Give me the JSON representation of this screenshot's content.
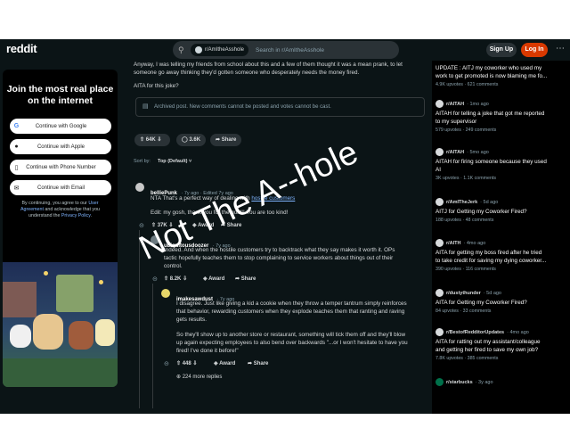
{
  "header": {
    "logo": "reddit",
    "chip": "r/AmItheAsshole",
    "search_placeholder": "Search in r/AmItheAsshole",
    "signup": "Sign Up",
    "login": "Log In"
  },
  "card": {
    "title": "Join the most real place on the internet",
    "google": "Continue with Google",
    "apple": "Continue with Apple",
    "phone": "Continue with Phone Number",
    "email": "Continue with Email",
    "terms_1": "By continuing, you agree to our",
    "terms_user": "User Agreement",
    "terms_2": "and acknowledge that you understand the",
    "terms_privacy": "Privacy Policy",
    "terms_end": "."
  },
  "post": {
    "body_1": "Anyway, I was telling my friends from school about this and a few of them thought it was a mean prank, to let",
    "body_2": "someone go away thinking they'd gotten someone who desperately needs the money fired.",
    "body_3": "AITA for this joke?",
    "archived": "Archived post. New comments cannot be posted and votes cannot be cast.",
    "votes": "64K",
    "comments": "3.6K",
    "share": "Share",
    "sort_label": "Sort by:",
    "sort_value": "Top (Default)"
  },
  "comments": [
    {
      "user": "belliePunk",
      "meta": "· 7y ago · Edited 7y ago",
      "text_a": "NTA That's a perfect way of dealing with",
      "text_link": "hostile customers",
      "text_b": "Edit: my gosh, thank you for the gold!! You are too kind!",
      "votes": "37K",
      "award": "Award",
      "share": "Share"
    },
    {
      "user": "ubiquitousdoozer",
      "meta": "· 7y ago",
      "text_a": "Indeed. And when the hostile customers try to backtrack what they say makes it worth it. OPs",
      "text_b": "tactic hopefully teaches them to stop complaining to service workers about things out of their",
      "text_c": "control.",
      "votes": "8.2K",
      "award": "Award",
      "share": "Share"
    },
    {
      "user": "imakesawdust",
      "meta": "· 7y ago",
      "text_a": "I disagree. Just like giving a kid a cookie when they throw a temper tantrum simply reinforces",
      "text_b": "that behavior, rewarding customers when they explode teaches them that ranting and raving",
      "text_c": "gets results.",
      "text_d": "So they'll show up to another store or restaurant, something will tick them off and they'll blow",
      "text_e": "up again expecting employees to also bend over backwards \"...or I won't hesitate to have you",
      "text_f": "fired! I've done it before!\"",
      "votes": "448",
      "award": "Award",
      "share": "Share",
      "more": "224 more replies"
    }
  ],
  "sidebar": [
    {
      "sub": "",
      "time": "",
      "title_1": "UPDATE : AITJ my coworker who used my",
      "title_2": "work to get promoted is now blaming me fo...",
      "upvotes": "4.9K upvotes",
      "comments": "621 comments"
    },
    {
      "sub": "r/AITAH",
      "time": "· 1mo ago",
      "title_1": "AITAH for telling a joke that got me reported",
      "title_2": "to my supervisor",
      "upvotes": "579 upvotes",
      "comments": "249 comments"
    },
    {
      "sub": "r/AITAH",
      "time": "· 5mo ago",
      "title_1": "AITAH for firing someone because they used",
      "title_2": "AI",
      "upvotes": "3K upvotes",
      "comments": "1.1K comments"
    },
    {
      "sub": "r/AmITheJerk",
      "time": "· 5d ago",
      "title_1": "AITJ for Getting my Coworker Fired?",
      "title_2": "",
      "upvotes": "188 upvotes",
      "comments": "48 comments"
    },
    {
      "sub": "r/AITH",
      "time": "· 4mo ago",
      "title_1": "AITA for getting my boss fired after he tried",
      "title_2": "to take credit for saving my dying coworker...",
      "upvotes": "390 upvotes",
      "comments": "116 comments"
    },
    {
      "sub": "r/dustythunder",
      "time": "· 5d ago",
      "title_1": "AITA for Getting my Coworker Fired?",
      "title_2": "",
      "upvotes": "84 upvotes",
      "comments": "33 comments"
    },
    {
      "sub": "r/BestofRedditorUpdates",
      "time": "· 4mo ago",
      "title_1": "AITA for ratting out my assistant/colleague",
      "title_2": "and getting her fired to save my own job?",
      "upvotes": "7.8K upvotes",
      "comments": "385 comments"
    },
    {
      "sub": "r/starbucks",
      "time": "· 3y ago",
      "title_1": "",
      "title_2": "",
      "upvotes": "",
      "comments": ""
    }
  ],
  "overlay": "Not The A--hole"
}
